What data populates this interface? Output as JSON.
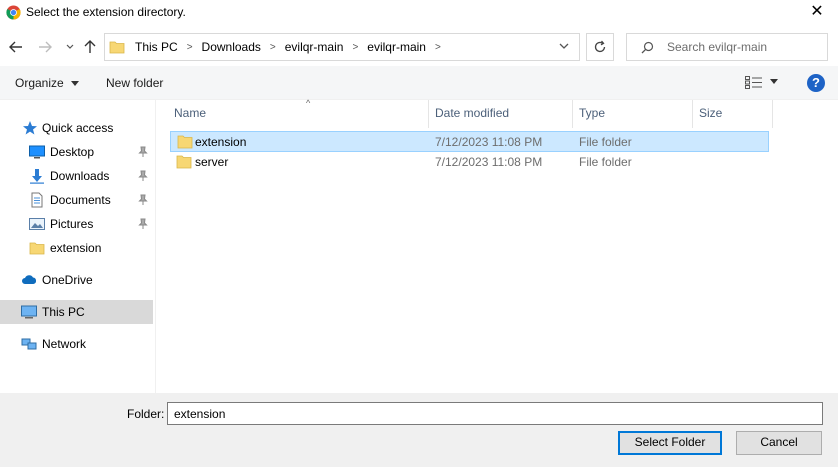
{
  "window": {
    "title": "Select the extension directory.",
    "close_label": "✕"
  },
  "address": {
    "crumbs": [
      "This PC",
      "Downloads",
      "evilqr-main",
      "evilqr-main"
    ]
  },
  "search": {
    "placeholder": "Search evilqr-main"
  },
  "toolbar": {
    "organize_label": "Organize",
    "new_folder_label": "New folder",
    "help_label": "?"
  },
  "sidebar": {
    "items": [
      {
        "label": "Quick access",
        "icon": "star-icon"
      },
      {
        "label": "Desktop",
        "icon": "desktop-icon",
        "pinned": true
      },
      {
        "label": "Downloads",
        "icon": "download-icon",
        "pinned": true
      },
      {
        "label": "Documents",
        "icon": "document-icon",
        "pinned": true
      },
      {
        "label": "Pictures",
        "icon": "pictures-icon",
        "pinned": true
      },
      {
        "label": "extension",
        "icon": "folder-icon"
      },
      {
        "label": "OneDrive",
        "icon": "cloud-icon"
      },
      {
        "label": "This PC",
        "icon": "computer-icon",
        "selected": true
      },
      {
        "label": "Network",
        "icon": "network-icon"
      }
    ]
  },
  "columns": {
    "name": "Name",
    "date": "Date modified",
    "type": "Type",
    "size": "Size"
  },
  "files": [
    {
      "name": "extension",
      "date": "7/12/2023 11:08 PM",
      "type": "File folder",
      "selected": true
    },
    {
      "name": "server",
      "date": "7/12/2023 11:08 PM",
      "type": "File folder",
      "selected": false
    }
  ],
  "footer": {
    "folder_label": "Folder:",
    "folder_value": "extension",
    "select_label": "Select Folder",
    "cancel_label": "Cancel"
  },
  "colors": {
    "selection_bg": "#cce8ff",
    "selection_border": "#99d1ff",
    "accent": "#0078d7",
    "folder": "#f7d774"
  }
}
